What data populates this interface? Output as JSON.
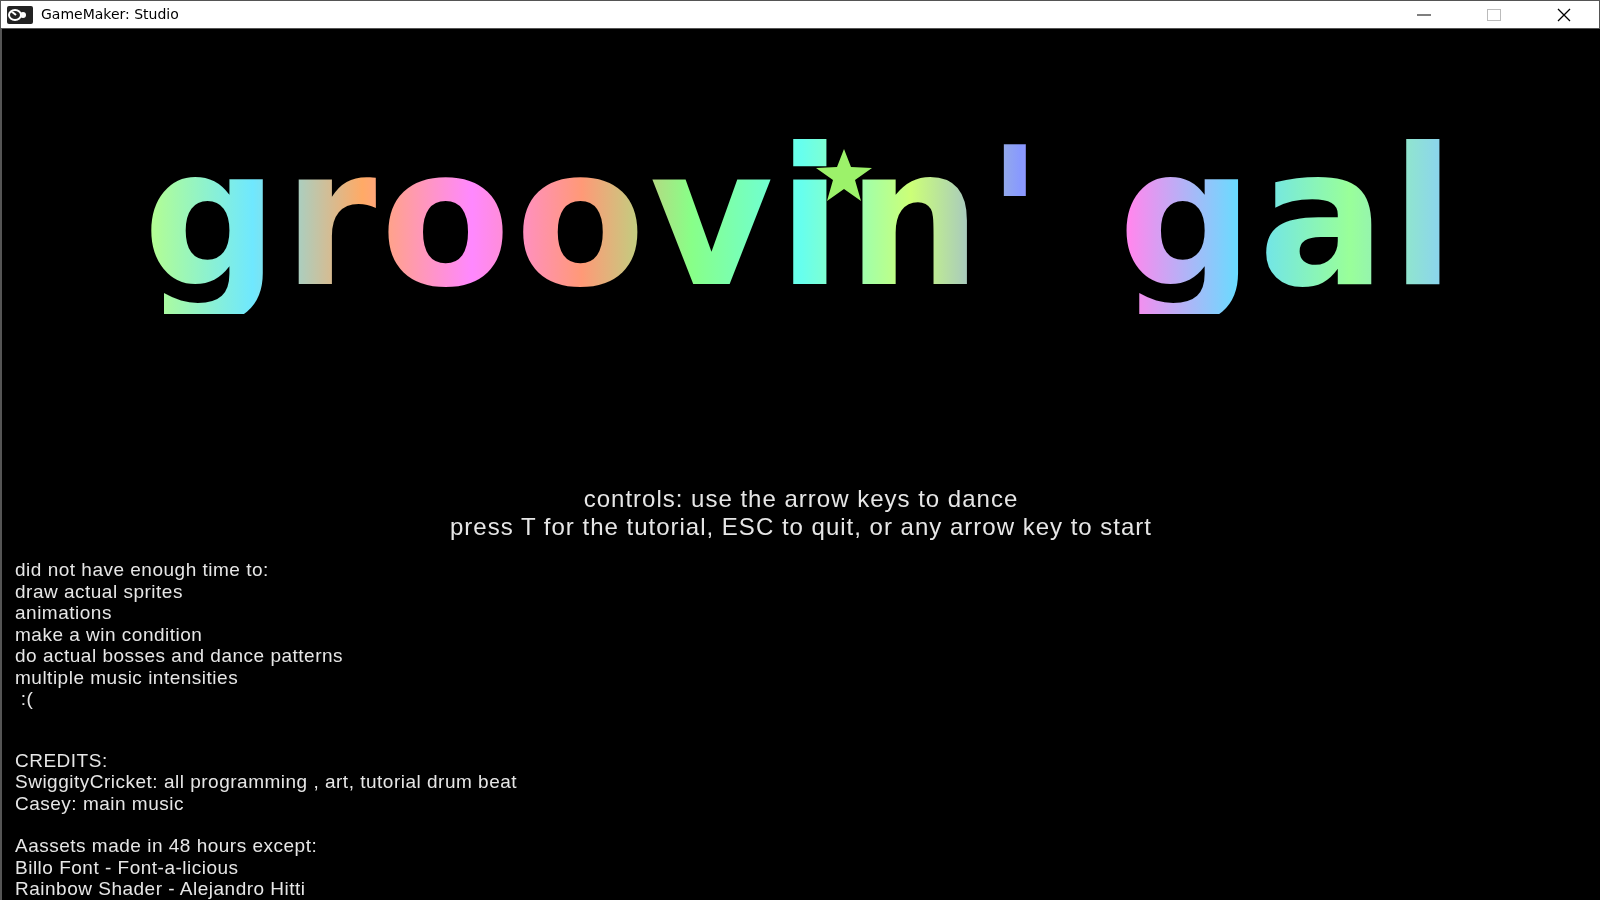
{
  "window": {
    "title": "GameMaker: Studio"
  },
  "logo": "groovin' gal",
  "instructions": [
    "controls: use the arrow keys to dance",
    "press T for the tutorial, ESC to quit, or any arrow key to start"
  ],
  "notes": [
    "did not have enough time to:",
    "draw actual sprites",
    "animations",
    "make a win condition",
    "do actual bosses and dance patterns",
    "multiple music intensities",
    " :("
  ],
  "credits": [
    "CREDITS:",
    "SwiggityCricket: all programming , art, tutorial drum beat",
    "Casey: main music"
  ],
  "assets": [
    "Aassets made in 48 hours except:",
    "Billo Font - Font-a-licious",
    "Rainbow Shader - Alejandro Hitti"
  ]
}
